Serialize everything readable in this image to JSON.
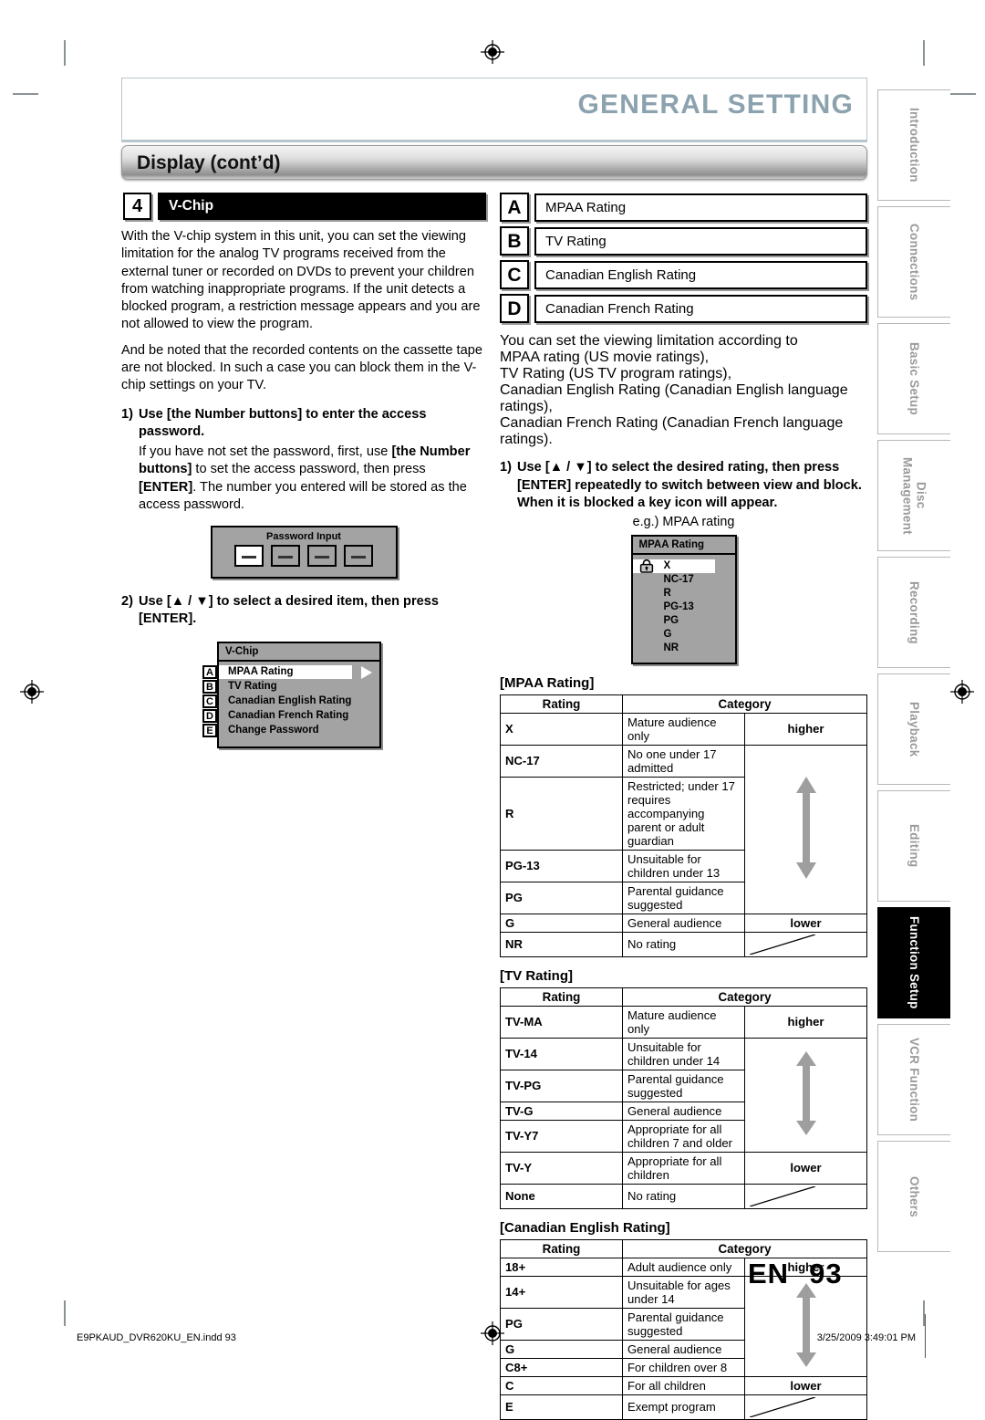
{
  "header": {
    "title": "GENERAL SETTING",
    "section": "Display (cont’d)"
  },
  "left_column": {
    "step_number": "4",
    "step_title": "V-Chip",
    "paragraph_1": "With the V-chip system in this unit, you can set the viewing limitation for the analog TV programs received from the external tuner or recorded on DVDs to prevent your children from watching inappropriate programs. If the unit detects a blocked program, a restriction message appears and you are not allowed to view the program.",
    "paragraph_2": "And be noted that the recorded contents on the cassette tape are not blocked. In such a case you can block them in the V-chip settings on your TV.",
    "step1_number": "1)",
    "step1_text": "Use [the Number buttons] to enter the access password.",
    "step1_sub": "If you have not set the password, first, use [the Number buttons] to set the access password, then press [ENTER]. The number you entered will be stored as the access password.",
    "password_osd": {
      "title": "Password Input",
      "cells": [
        "—",
        "—",
        "—",
        "—"
      ],
      "active_index": 0
    },
    "step2_number": "2)",
    "step2_text": "Use [▲ / ▼] to select a desired item, then press [ENTER].",
    "vchip_osd": {
      "title": "V-Chip",
      "items": [
        {
          "tag": "A",
          "label": "MPAA Rating",
          "selected": true
        },
        {
          "tag": "B",
          "label": "TV Rating",
          "selected": false
        },
        {
          "tag": "C",
          "label": "Canadian English Rating",
          "selected": false
        },
        {
          "tag": "D",
          "label": "Canadian French Rating",
          "selected": false
        },
        {
          "tag": "E",
          "label": "Change Password",
          "selected": false
        }
      ]
    }
  },
  "right_column": {
    "abcd": [
      {
        "tag": "A",
        "label": "MPAA Rating"
      },
      {
        "tag": "B",
        "label": "TV Rating"
      },
      {
        "tag": "C",
        "label": "Canadian English Rating"
      },
      {
        "tag": "D",
        "label": "Canadian French Rating"
      }
    ],
    "description_lines": [
      "You can set the viewing limitation according to",
      "MPAA rating (US movie ratings),",
      "TV Rating (US TV program ratings),",
      "Canadian English Rating (Canadian English language ratings),",
      "Canadian French Rating (Canadian French language ratings)."
    ],
    "step1_number": "1)",
    "step1_text": "Use [▲ / ▼] to select the desired rating, then press [ENTER] repeatedly to switch between view and block. When it is blocked a key icon will appear.",
    "eg_label": "e.g.) MPAA rating",
    "mpaa_osd": {
      "title": "MPAA Rating",
      "items": [
        "X",
        "NC-17",
        "R",
        "PG-13",
        "PG",
        "G",
        "NR"
      ],
      "selected": "X",
      "lock_icon": "lock-icon"
    },
    "tables": [
      {
        "title": "[MPAA Rating]",
        "columns": [
          "Rating",
          "Category"
        ],
        "higher_label": "higher",
        "lower_label": "lower",
        "rows": [
          {
            "rating": "X",
            "category": "Mature audience only"
          },
          {
            "rating": "NC-17",
            "category": "No one under 17 admitted"
          },
          {
            "rating": "R",
            "category": "Restricted; under 17 requires accompanying parent or adult guardian"
          },
          {
            "rating": "PG-13",
            "category": "Unsuitable for children under 13"
          },
          {
            "rating": "PG",
            "category": "Parental guidance suggested"
          },
          {
            "rating": "G",
            "category": "General audience"
          },
          {
            "rating": "NR",
            "category": "No rating"
          }
        ]
      },
      {
        "title": "[TV Rating]",
        "columns": [
          "Rating",
          "Category"
        ],
        "higher_label": "higher",
        "lower_label": "lower",
        "rows": [
          {
            "rating": "TV-MA",
            "category": "Mature audience only"
          },
          {
            "rating": "TV-14",
            "category": "Unsuitable for children under 14"
          },
          {
            "rating": "TV-PG",
            "category": "Parental guidance suggested"
          },
          {
            "rating": "TV-G",
            "category": "General audience"
          },
          {
            "rating": "TV-Y7",
            "category": "Appropriate for all children 7 and older"
          },
          {
            "rating": "TV-Y",
            "category": "Appropriate for all children"
          },
          {
            "rating": "None",
            "category": "No rating"
          }
        ]
      },
      {
        "title": "[Canadian English Rating]",
        "columns": [
          "Rating",
          "Category"
        ],
        "higher_label": "higher",
        "lower_label": "lower",
        "rows": [
          {
            "rating": "18+",
            "category": "Adult audience only"
          },
          {
            "rating": "14+",
            "category": "Unsuitable for ages under 14"
          },
          {
            "rating": "PG",
            "category": "Parental guidance suggested"
          },
          {
            "rating": "G",
            "category": "General audience"
          },
          {
            "rating": "C8+",
            "category": "For children over 8"
          },
          {
            "rating": "C",
            "category": "For all children"
          },
          {
            "rating": "E",
            "category": "Exempt program"
          }
        ]
      }
    ]
  },
  "tab_index": [
    {
      "label": "Introduction",
      "active": false
    },
    {
      "label": "Connections",
      "active": false
    },
    {
      "label": "Basic Setup",
      "active": false
    },
    {
      "label": "Disc Management",
      "active": false
    },
    {
      "label": "Recording",
      "active": false
    },
    {
      "label": "Playback",
      "active": false
    },
    {
      "label": "Editing",
      "active": false
    },
    {
      "label": "Function Setup",
      "active": true
    },
    {
      "label": "VCR Function",
      "active": false
    },
    {
      "label": "Others",
      "active": false
    }
  ],
  "page_footer": {
    "lang": "EN",
    "page_number": "93",
    "file_name": "E9PKAUD_DVR620KU_EN.indd   93",
    "timestamp": "3/25/2009   3:49:01 PM"
  },
  "colors": {
    "title": "#8ca3af",
    "osd_gray": "#a3a3a3",
    "tab_inactive_text": "#9a9a9a",
    "arrow_gray": "#9e9e9e"
  }
}
